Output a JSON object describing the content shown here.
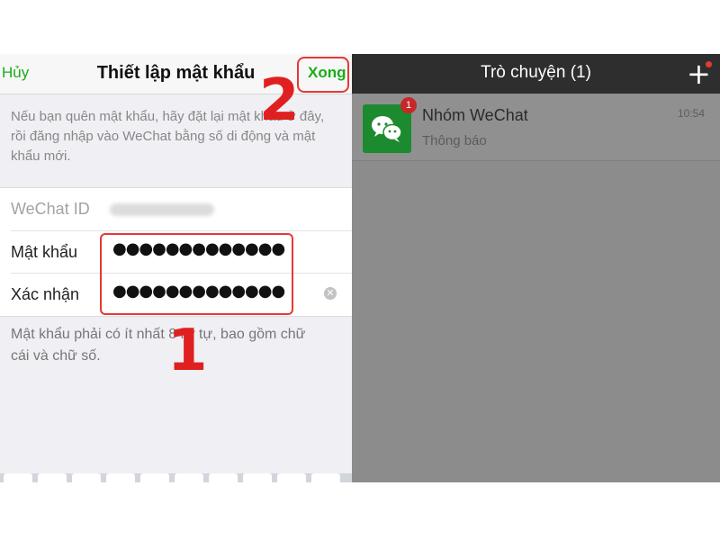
{
  "left_panel": {
    "nav": {
      "cancel_label": "Hủy",
      "title": "Thiết lập mật khẩu",
      "done_label": "Xong"
    },
    "hint_text": "Nếu bạn quên mật khẩu, hãy đặt lại mật khẩu ở đây, rồi đăng nhập vào WeChat bằng số di động và mật khẩu mới.",
    "form": {
      "wechat_id_label": "WeChat ID",
      "password_label": "Mật khẩu",
      "password_value": "●●●●●●●●●●●●●",
      "confirm_label": "Xác nhận",
      "confirm_value": "●●●●●●●●●●●●●"
    },
    "rule_text": "Mật khẩu phải có ít nhất 8 ký tự, bao gồm chữ cái và chữ số.",
    "annotations": {
      "step_1": "1",
      "step_2": "2"
    }
  },
  "right_panel": {
    "title": "Trò chuyện (1)",
    "add_icon": "plus-icon",
    "chats": [
      {
        "name": "Nhóm WeChat",
        "preview": "Thông báo",
        "time": "10:54",
        "unread": "1",
        "avatar_icon": "wechat-logo-icon"
      }
    ]
  },
  "colors": {
    "accent_green": "#1aad19",
    "highlight_red": "#e53935",
    "chat_header": "#2e2e2e"
  }
}
